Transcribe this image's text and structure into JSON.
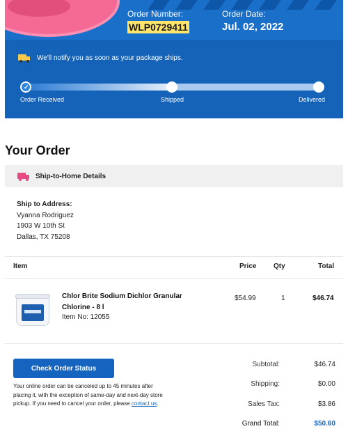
{
  "header": {
    "order_number_label": "Order Number:",
    "order_number": "WLP0729411",
    "order_date_label": "Order Date:",
    "order_date": "Jul. 02, 2022",
    "notify_text": "We'll notify you as soon as your package ships.",
    "colors": {
      "banner": "#1463b8",
      "highlight": "#ffe66b"
    }
  },
  "progress": {
    "steps": [
      "Order Received",
      "Shipped",
      "Delivered"
    ],
    "completed_steps": 1
  },
  "order": {
    "title": "Your Order",
    "ship_section_title": "Ship-to-Home Details",
    "ship_to_heading": "Ship to Address:",
    "ship_to_lines": [
      "Vyanna Rodriguez",
      "1903 W 10th St",
      "Dallas, TX 75208"
    ]
  },
  "table": {
    "headers": {
      "item": "Item",
      "price": "Price",
      "qty": "Qty",
      "total": "Total"
    },
    "items": [
      {
        "name": "Chlor Brite Sodium Dichlor Granular Chlorine - 8 l",
        "item_no": "Item No: 12055",
        "price": "$54.99",
        "qty": "1",
        "total": "$46.74"
      }
    ]
  },
  "actions": {
    "check_status_label": "Check Order Status",
    "cancel_note": "Your online order can be canceled up to 45 minutes after placing it, with the exception of same-day and next-day store pickup. If you need to cancel your order, please",
    "contact_link": "contact us",
    "cancel_note_end": "."
  },
  "summary": {
    "subtotal_label": "Subtotal:",
    "subtotal": "$46.74",
    "shipping_label": "Shipping:",
    "shipping": "$0.00",
    "tax_label": "Sales Tax:",
    "tax": "$3.86",
    "grand_label": "Grand Total:",
    "grand": "$50.60"
  },
  "icons": [
    "delivery-truck-icon",
    "pink-truck-icon",
    "check-icon"
  ]
}
